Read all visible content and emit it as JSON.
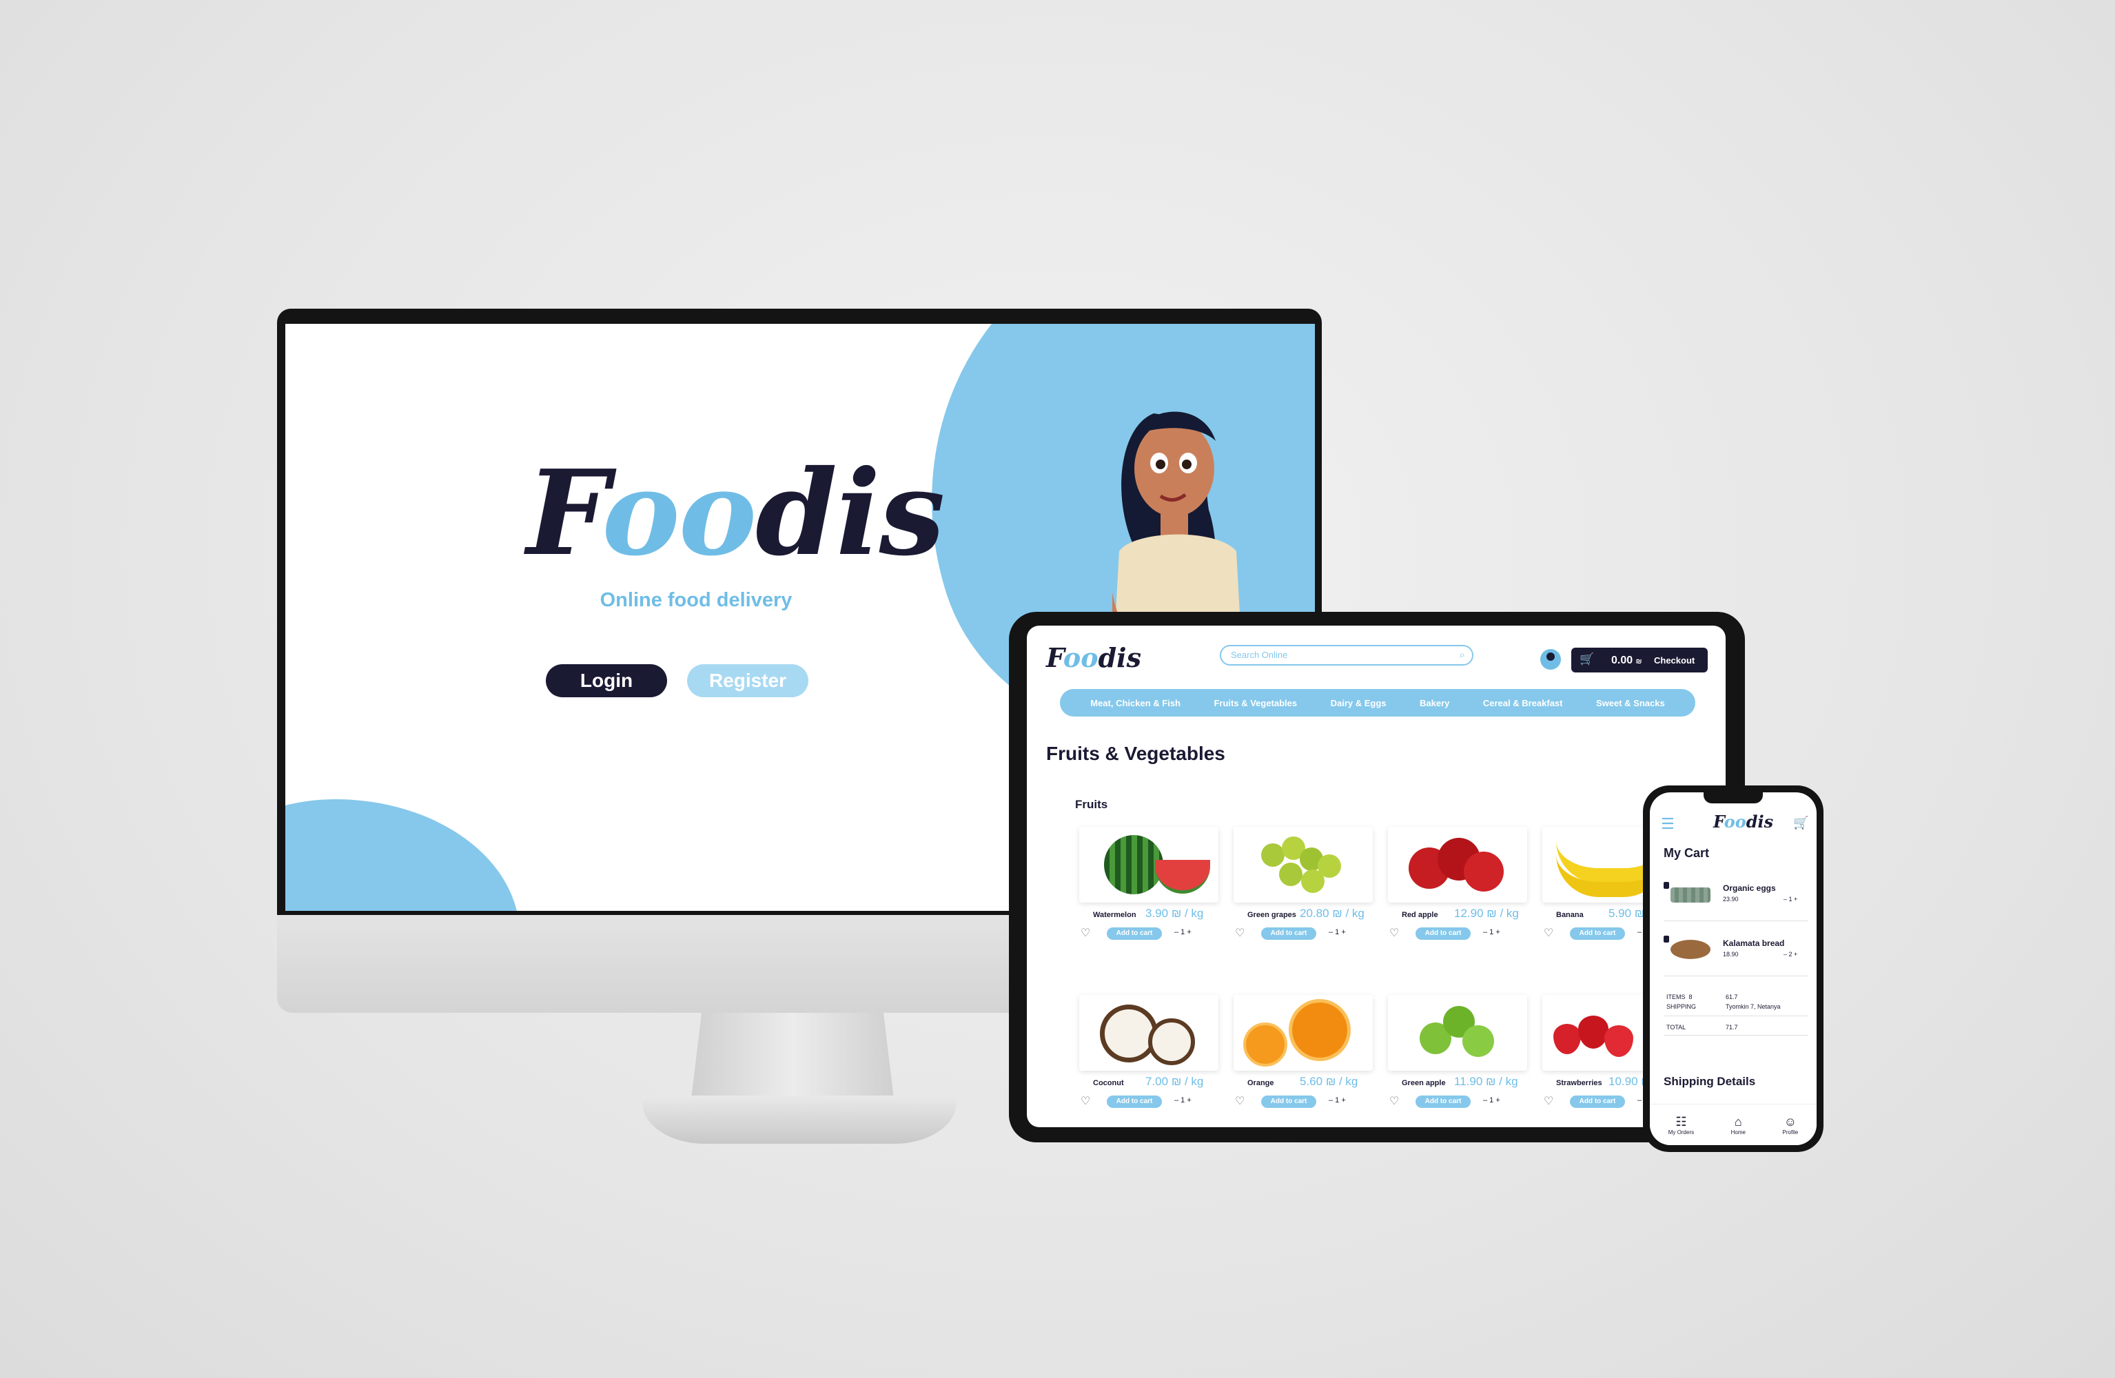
{
  "desktop": {
    "logo": {
      "part1": "F",
      "part2": "oo",
      "part3": "dis"
    },
    "tagline": "Online food delivery",
    "login_label": "Login",
    "register_label": "Register"
  },
  "tablet": {
    "logo": {
      "part1": "F",
      "part2": "oo",
      "part3": "dis"
    },
    "search_placeholder": "Search Online",
    "cart_total": "0.00",
    "currency": "₪",
    "checkout_label": "Checkout",
    "nav": [
      "Meat, Chicken & Fish",
      "Fruits & Vegetables",
      "Dairy & Eggs",
      "Bakery",
      "Cereal & Breakfast",
      "Sweet & Snacks"
    ],
    "page_title": "Fruits & Vegetables",
    "section_title": "Fruits",
    "add_to_cart": "Add to cart",
    "qty": "– 1 +",
    "products": [
      {
        "name": "Watermelon",
        "price": "3.90",
        "unit": "₪ / kg"
      },
      {
        "name": "Green grapes",
        "price": "20.80",
        "unit": "₪ / kg"
      },
      {
        "name": "Red apple",
        "price": "12.90",
        "unit": "₪ / kg"
      },
      {
        "name": "Banana",
        "price": "5.90",
        "unit": "₪ / k"
      },
      {
        "name": "Coconut",
        "price": "7.00",
        "unit": "₪ / kg"
      },
      {
        "name": "Orange",
        "price": "5.60",
        "unit": "₪ / kg"
      },
      {
        "name": "Green apple",
        "price": "11.90",
        "unit": "₪ / kg"
      },
      {
        "name": "Strawberries",
        "price": "10.90",
        "unit": "₪"
      }
    ]
  },
  "phone": {
    "logo": {
      "part1": "F",
      "part2": "oo",
      "part3": "dis"
    },
    "cart_title": "My Cart",
    "items": [
      {
        "name": "Organic eggs",
        "price": "23.90",
        "qty": "– 1 +"
      },
      {
        "name": "Kalamata bread",
        "price": "18.90",
        "qty": "– 2 +"
      }
    ],
    "items_label": "ITEMS",
    "items_count": "8",
    "items_value": "61.7",
    "shipping_label": "SHIPPING",
    "shipping_value": "Tyomkin 7, Netanya",
    "total_label": "TOTAL",
    "total_value": "71.7",
    "shipping_details_title": "Shipping Details",
    "bottom_nav": [
      "My Orders",
      "Home",
      "Profile"
    ]
  },
  "colors": {
    "brand_dark": "#1b1a33",
    "brand_light": "#85c8eb",
    "accent_text": "#6fbde6"
  }
}
